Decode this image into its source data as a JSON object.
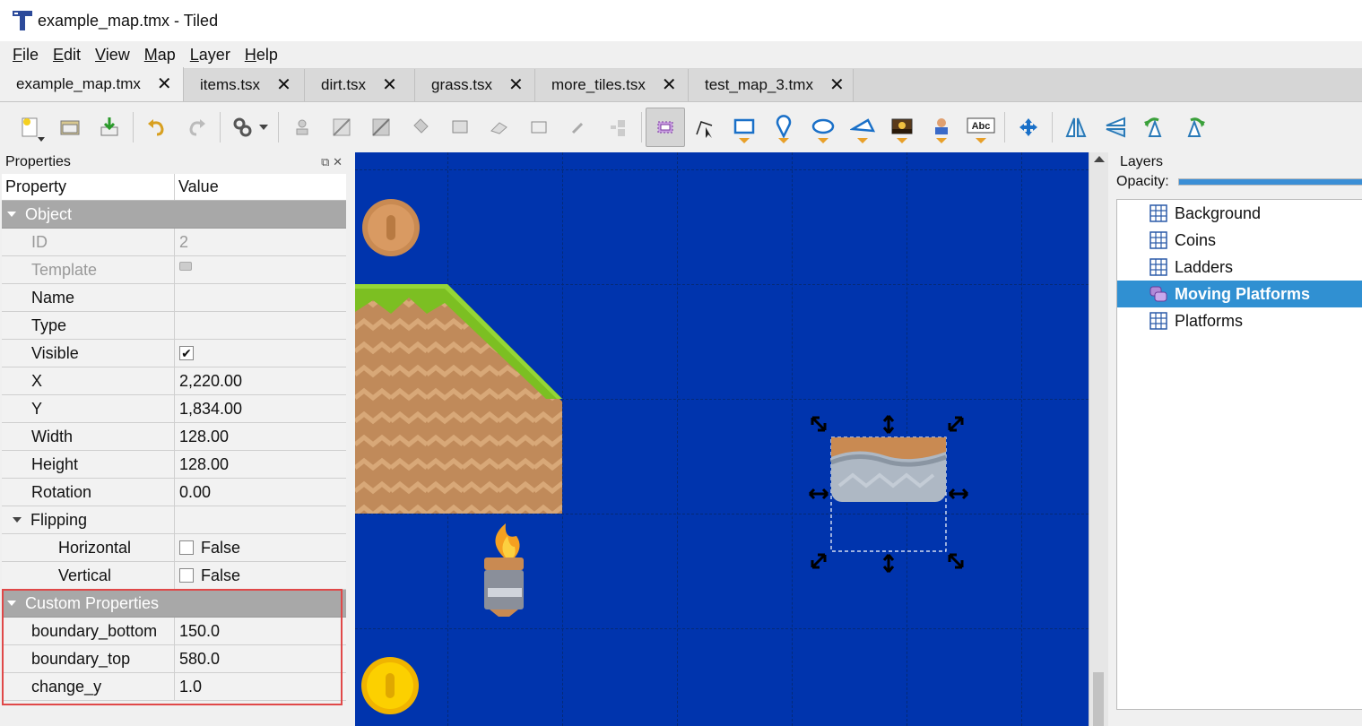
{
  "window": {
    "title": "example_map.tmx - Tiled"
  },
  "menu": [
    "File",
    "Edit",
    "View",
    "Map",
    "Layer",
    "Help"
  ],
  "tabs": [
    {
      "label": "example_map.tmx",
      "active": true
    },
    {
      "label": "items.tsx",
      "active": false
    },
    {
      "label": "dirt.tsx",
      "active": false
    },
    {
      "label": "grass.tsx",
      "active": false
    },
    {
      "label": "more_tiles.tsx",
      "active": false
    },
    {
      "label": "test_map_3.tmx",
      "active": false
    }
  ],
  "toolbar": {
    "text_tool_label": "Abc"
  },
  "properties": {
    "title": "Properties",
    "col_property": "Property",
    "col_value": "Value",
    "object_group": "Object",
    "id_label": "ID",
    "id_value": "2",
    "template_label": "Template",
    "name_label": "Name",
    "name_value": "",
    "type_label": "Type",
    "type_value": "",
    "visible_label": "Visible",
    "visible_value": true,
    "x_label": "X",
    "x_value": "2,220.00",
    "y_label": "Y",
    "y_value": "1,834.00",
    "width_label": "Width",
    "width_value": "128.00",
    "height_label": "Height",
    "height_value": "128.00",
    "rotation_label": "Rotation",
    "rotation_value": "0.00",
    "flipping_label": "Flipping",
    "horizontal_label": "Horizontal",
    "horizontal_value": "False",
    "vertical_label": "Vertical",
    "vertical_value": "False",
    "custom_group": "Custom Properties",
    "custom": [
      {
        "key": "boundary_bottom",
        "value": "150.0"
      },
      {
        "key": "boundary_top",
        "value": "580.0"
      },
      {
        "key": "change_y",
        "value": "1.0"
      }
    ]
  },
  "layers": {
    "title": "Layers",
    "opacity_label": "Opacity:",
    "opacity": 1.0,
    "items": [
      {
        "label": "Background",
        "type": "tile",
        "selected": false
      },
      {
        "label": "Coins",
        "type": "tile",
        "selected": false
      },
      {
        "label": "Ladders",
        "type": "tile",
        "selected": false
      },
      {
        "label": "Moving Platforms",
        "type": "object",
        "selected": true
      },
      {
        "label": "Platforms",
        "type": "tile",
        "selected": false
      }
    ]
  },
  "colors": {
    "map_background": "#0034ad",
    "selection_highlight": "#3090d2",
    "annotation_box": "#e04848"
  }
}
